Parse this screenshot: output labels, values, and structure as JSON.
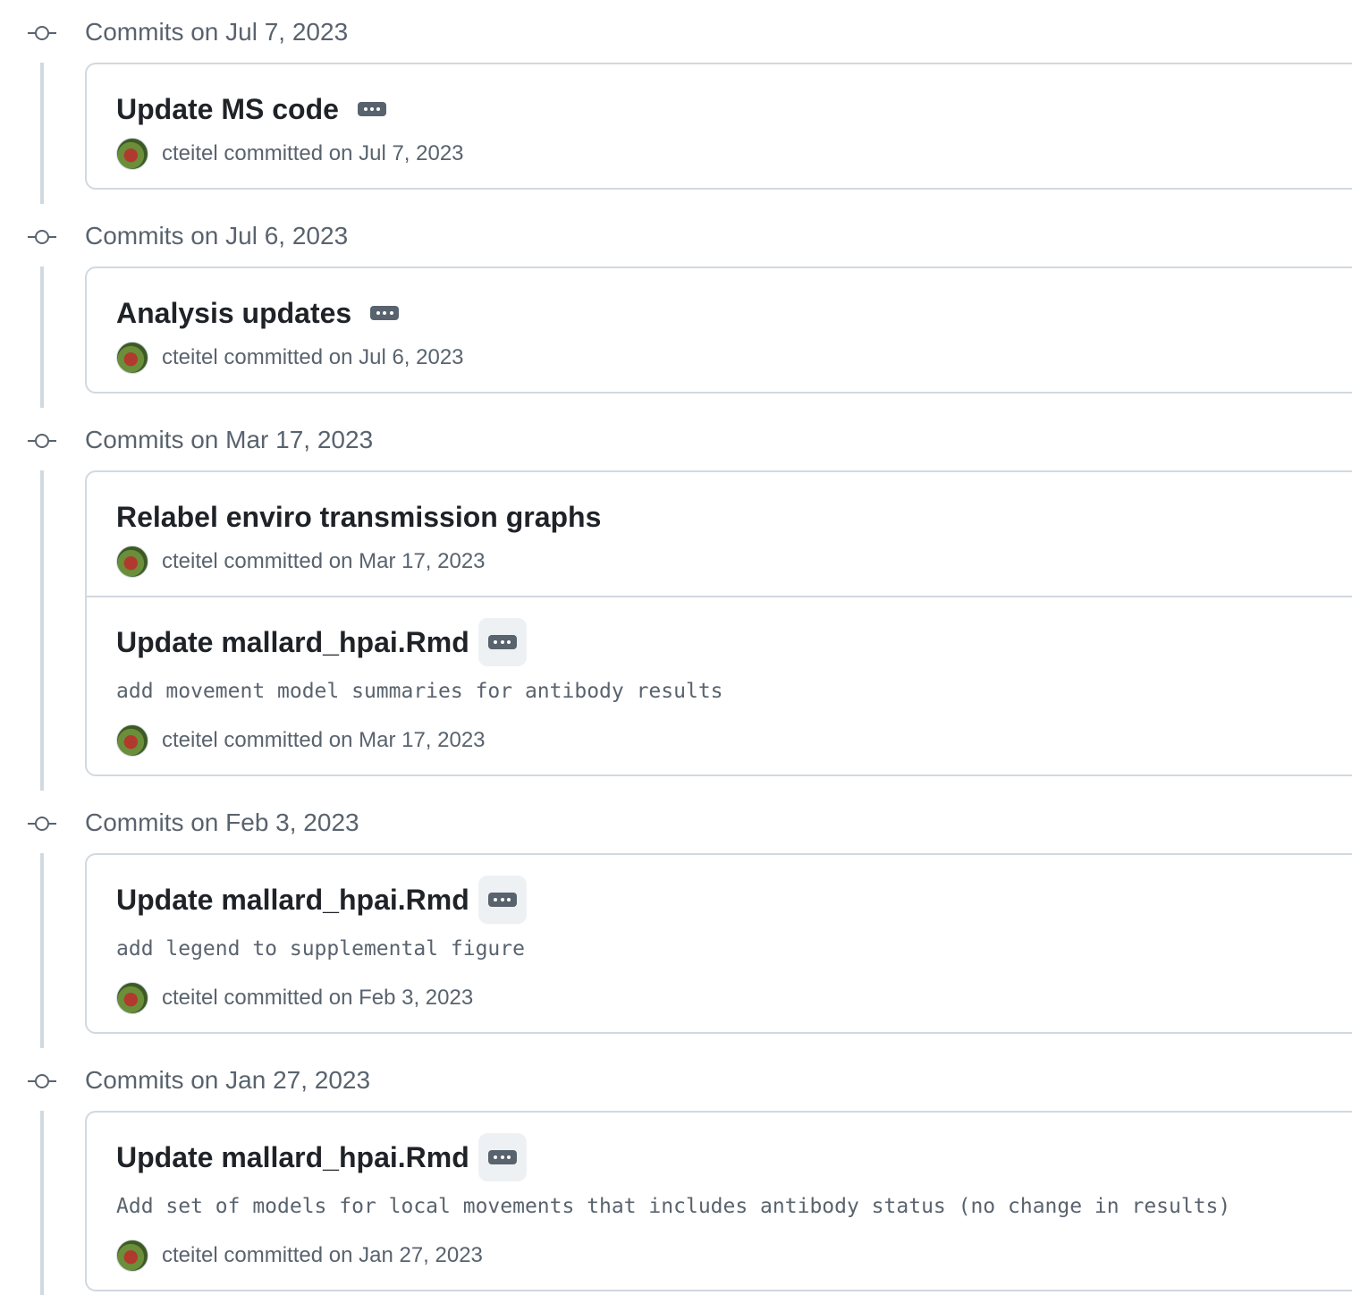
{
  "groups": [
    {
      "title": "Commits on Jul 7, 2023",
      "commits": [
        {
          "title": "Update MS code",
          "description": "",
          "author": "cteitel",
          "committed": "committed on Jul 7, 2023",
          "has_more": true,
          "more_shaded": false
        }
      ]
    },
    {
      "title": "Commits on Jul 6, 2023",
      "commits": [
        {
          "title": "Analysis updates",
          "description": "",
          "author": "cteitel",
          "committed": "committed on Jul 6, 2023",
          "has_more": true,
          "more_shaded": false
        }
      ]
    },
    {
      "title": "Commits on Mar 17, 2023",
      "commits": [
        {
          "title": "Relabel enviro transmission graphs",
          "description": "",
          "author": "cteitel",
          "committed": "committed on Mar 17, 2023",
          "has_more": false,
          "more_shaded": false
        },
        {
          "title": "Update mallard_hpai.Rmd",
          "description": "add movement model summaries for antibody results",
          "author": "cteitel",
          "committed": "committed on Mar 17, 2023",
          "has_more": true,
          "more_shaded": true
        }
      ]
    },
    {
      "title": "Commits on Feb 3, 2023",
      "commits": [
        {
          "title": "Update mallard_hpai.Rmd",
          "description": "add legend to supplemental figure",
          "author": "cteitel",
          "committed": "committed on Feb 3, 2023",
          "has_more": true,
          "more_shaded": true
        }
      ]
    },
    {
      "title": "Commits on Jan 27, 2023",
      "commits": [
        {
          "title": "Update mallard_hpai.Rmd",
          "description": "Add set of models for local movements that includes antibody status (no change in results)",
          "author": "cteitel",
          "committed": "committed on Jan 27, 2023",
          "has_more": true,
          "more_shaded": true
        }
      ]
    }
  ],
  "icons": {
    "group": "git-commit-icon",
    "more": "kebab-horizontal-icon"
  },
  "colors": {
    "text": "#1f2328",
    "muted": "#59636e",
    "border": "#d1d9e0",
    "button_bg": "#eef1f4"
  }
}
